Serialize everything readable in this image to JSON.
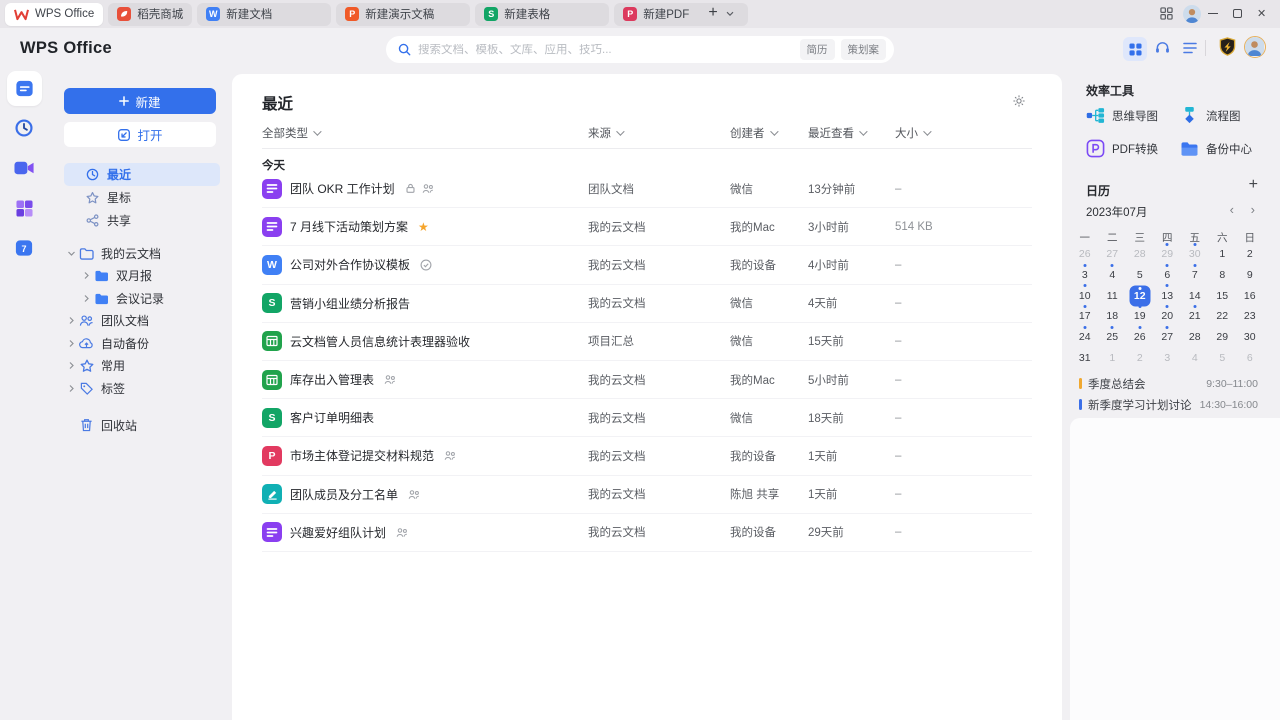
{
  "colors": {
    "accent": "#3370eb",
    "star": "#f6a52c",
    "event_orange": "#f0a830",
    "event_blue": "#3b6fe8"
  },
  "tabbar": {
    "active_tab": {
      "label": "WPS Office",
      "kind": "wps"
    },
    "tabs": [
      {
        "label": "稻壳商城",
        "kind": "docer"
      },
      {
        "label": "新建文档",
        "kind": "writer"
      },
      {
        "label": "新建演示文稿",
        "kind": "presentation"
      },
      {
        "label": "新建表格",
        "kind": "spreadsheet"
      },
      {
        "label": "新建PDF",
        "kind": "pdf"
      }
    ]
  },
  "header": {
    "logo_text": "WPS Office",
    "search": {
      "placeholder": "搜索文档、模板、文库、应用、技巧...",
      "tags": [
        "简历",
        "策划案"
      ]
    }
  },
  "rail": {
    "items": [
      {
        "icon": "rail-doc",
        "name": "documents",
        "active": true
      },
      {
        "icon": "rail-clock",
        "name": "recent",
        "active": false
      },
      {
        "icon": "rail-video",
        "name": "meeting",
        "active": false
      },
      {
        "icon": "rail-apps",
        "name": "apps",
        "active": false
      },
      {
        "icon": "rail-cal7",
        "name": "calendar",
        "active": false
      }
    ]
  },
  "sidebar": {
    "new_button": "新建",
    "open_button": "打开",
    "nav_items": [
      {
        "label": "最近",
        "icon": "clock",
        "active": true
      },
      {
        "label": "星标",
        "icon": "star",
        "active": false
      },
      {
        "label": "共享",
        "icon": "share",
        "active": false
      }
    ],
    "tree_items": [
      {
        "label": "我的云文档",
        "icon": "cloud-folder",
        "level": 0,
        "expanded": true
      },
      {
        "label": "双月报",
        "icon": "folder",
        "level": 1,
        "expanded": false
      },
      {
        "label": "会议记录",
        "icon": "folder",
        "level": 1,
        "expanded": false
      },
      {
        "label": "团队文档",
        "icon": "team",
        "level": 0,
        "expanded": false
      },
      {
        "label": "自动备份",
        "icon": "cloud-upload",
        "level": 0,
        "expanded": false
      },
      {
        "label": "常用",
        "icon": "pin-star",
        "level": 0,
        "expanded": false
      },
      {
        "label": "标签",
        "icon": "tag",
        "level": 0,
        "expanded": false
      }
    ],
    "trash_label": "回收站"
  },
  "main": {
    "title": "最近",
    "filters": [
      "全部类型",
      "来源",
      "创建者",
      "最近查看",
      "大小"
    ],
    "group_label": "今天",
    "files": [
      {
        "name": "团队 OKR 工作计划",
        "type": "doc-purple",
        "badges": [
          "lock",
          "collab"
        ],
        "source": "团队文档",
        "creator": "微信",
        "viewed": "13分钟前",
        "size": "–"
      },
      {
        "name": "7 月线下活动策划方案",
        "type": "doc-purple",
        "badges": [
          "star"
        ],
        "source": "我的云文档",
        "creator": "我的Mac",
        "viewed": "3小时前",
        "size": "514 KB"
      },
      {
        "name": "公司对外合作协议模板",
        "type": "doc-writer",
        "badges": [
          "check"
        ],
        "source": "我的云文档",
        "creator": "我的设备",
        "viewed": "4小时前",
        "size": "–"
      },
      {
        "name": "营销小组业绩分析报告",
        "type": "sheet-green",
        "badges": [],
        "source": "我的云文档",
        "creator": "微信",
        "viewed": "4天前",
        "size": "–"
      },
      {
        "name": "云文档管人员信息统计表理器验收",
        "type": "sheet-grid",
        "badges": [],
        "source": "项目汇总",
        "creator": "微信",
        "viewed": "15天前",
        "size": "–"
      },
      {
        "name": "库存出入管理表",
        "type": "sheet-grid",
        "badges": [
          "collab"
        ],
        "source": "我的云文档",
        "creator": "我的Mac",
        "viewed": "5小时前",
        "size": "–"
      },
      {
        "name": "客户订单明细表",
        "type": "sheet-green",
        "badges": [],
        "source": "我的云文档",
        "creator": "微信",
        "viewed": "18天前",
        "size": "–"
      },
      {
        "name": "市场主体登记提交材料规范",
        "type": "pdf",
        "badges": [
          "collab"
        ],
        "source": "我的云文档",
        "creator": "我的设备",
        "viewed": "1天前",
        "size": "–"
      },
      {
        "name": "团队成员及分工名单",
        "type": "form-teal",
        "badges": [
          "collab"
        ],
        "source": "我的云文档",
        "creator": "陈旭 共享",
        "viewed": "1天前",
        "size": "–"
      },
      {
        "name": "兴趣爱好组队计划",
        "type": "doc-purple",
        "badges": [
          "collab"
        ],
        "source": "我的云文档",
        "creator": "我的设备",
        "viewed": "29天前",
        "size": "–"
      }
    ]
  },
  "tools_panel": {
    "title": "效率工具",
    "tools": [
      {
        "label": "思维导图",
        "icon": "mindmap"
      },
      {
        "label": "流程图",
        "icon": "flowchart"
      },
      {
        "label": "PDF转换",
        "icon": "pdf-convert"
      },
      {
        "label": "备份中心",
        "icon": "backup"
      }
    ]
  },
  "calendar": {
    "title": "日历",
    "month_label": "2023年07月",
    "weekdays": [
      "一",
      "二",
      "三",
      "四",
      "五",
      "六",
      "日"
    ],
    "days": [
      {
        "d": "26",
        "muted": true
      },
      {
        "d": "27",
        "muted": true
      },
      {
        "d": "28",
        "muted": true
      },
      {
        "d": "29",
        "muted": true,
        "dot": true
      },
      {
        "d": "30",
        "muted": true,
        "dot": true
      },
      {
        "d": "1"
      },
      {
        "d": "2"
      },
      {
        "d": "3",
        "dot": true
      },
      {
        "d": "4",
        "dot": true
      },
      {
        "d": "5"
      },
      {
        "d": "6",
        "dot": true
      },
      {
        "d": "7",
        "dot": true
      },
      {
        "d": "8"
      },
      {
        "d": "9"
      },
      {
        "d": "10",
        "dot": true
      },
      {
        "d": "11"
      },
      {
        "d": "12",
        "selected": true,
        "dot": true
      },
      {
        "d": "13",
        "dot": true
      },
      {
        "d": "14"
      },
      {
        "d": "15"
      },
      {
        "d": "16"
      },
      {
        "d": "17",
        "dot": true
      },
      {
        "d": "18"
      },
      {
        "d": "19",
        "dot": true
      },
      {
        "d": "20",
        "dot": true
      },
      {
        "d": "21",
        "dot": true
      },
      {
        "d": "22"
      },
      {
        "d": "23"
      },
      {
        "d": "24",
        "dot": true
      },
      {
        "d": "25",
        "dot": true
      },
      {
        "d": "26",
        "dot": true
      },
      {
        "d": "27",
        "dot": true
      },
      {
        "d": "28"
      },
      {
        "d": "29"
      },
      {
        "d": "30"
      },
      {
        "d": "31"
      },
      {
        "d": "1",
        "muted": true
      },
      {
        "d": "2",
        "muted": true
      },
      {
        "d": "3",
        "muted": true
      },
      {
        "d": "4",
        "muted": true
      },
      {
        "d": "5",
        "muted": true
      },
      {
        "d": "6",
        "muted": true
      }
    ],
    "events": [
      {
        "title": "季度总结会",
        "time": "9:30–11:00",
        "color": "#f0a830"
      },
      {
        "title": "新季度学习计划讨论",
        "time": "14:30–16:00",
        "color": "#3b6fe8"
      }
    ]
  }
}
